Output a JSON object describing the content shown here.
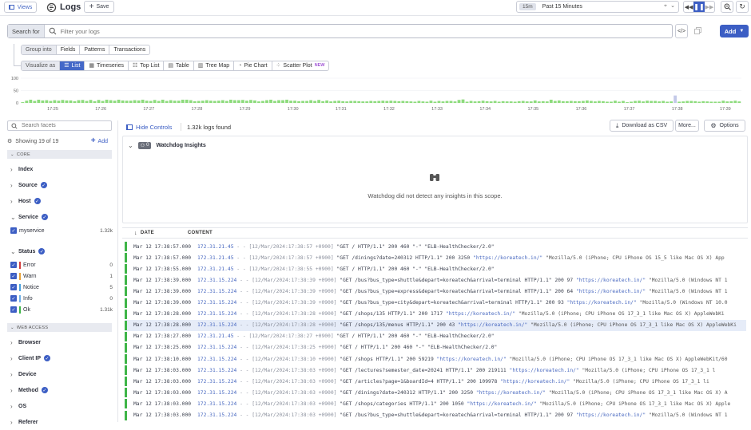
{
  "topbar": {
    "views_label": "Views",
    "title": "Logs",
    "save_label": "Save",
    "time_badge": "15m",
    "time_range": "Past 15 Minutes"
  },
  "search": {
    "label": "Search for",
    "placeholder": "Filter your logs",
    "add_label": "Add"
  },
  "group": {
    "label": "Group into",
    "options": [
      "Fields",
      "Patterns",
      "Transactions"
    ]
  },
  "visualize": {
    "label": "Visualize as",
    "options": [
      "List",
      "Timeseries",
      "Top List",
      "Table",
      "Tree Map",
      "Pie Chart",
      "Scatter Plot"
    ],
    "new_badge": "NEW"
  },
  "histogram": {
    "y_ticks": [
      "100",
      "50",
      "0"
    ],
    "x_ticks": [
      "17:25",
      "17:26",
      "17:27",
      "17:28",
      "17:29",
      "17:30",
      "17:31",
      "17:32",
      "17:33",
      "17:34",
      "17:35",
      "17:36",
      "17:37",
      "17:38",
      "17:39"
    ],
    "bars": [
      3,
      9,
      13,
      8,
      13,
      10,
      11,
      8,
      11,
      9,
      12,
      10,
      10,
      7,
      11,
      12,
      8,
      12,
      7,
      12,
      8,
      13,
      11,
      9,
      13,
      10,
      9,
      9,
      11,
      10,
      13,
      9,
      8,
      12,
      8,
      13,
      8,
      11,
      9,
      9,
      13,
      13,
      11,
      7,
      8,
      9,
      11,
      9,
      8,
      9,
      11,
      8,
      13,
      11,
      11,
      12,
      9,
      12,
      10,
      6,
      8,
      11,
      13,
      8,
      11,
      11,
      13,
      9,
      9,
      7,
      8,
      8,
      11,
      8,
      12,
      7,
      10,
      6,
      8,
      9,
      7,
      6,
      8,
      8,
      7,
      6,
      6,
      8,
      7,
      8,
      9,
      8,
      9,
      8,
      7,
      8,
      7,
      6,
      5,
      8,
      6,
      5,
      9,
      5,
      8,
      6,
      8,
      8,
      6,
      12,
      14,
      5,
      8,
      6,
      7,
      9,
      7,
      6,
      8,
      5,
      7,
      6,
      6,
      5,
      7,
      8,
      6,
      6,
      10,
      6,
      7,
      6,
      13,
      8,
      10,
      7,
      7,
      8,
      7,
      7,
      8,
      10,
      8,
      6,
      8,
      7,
      5,
      5,
      9,
      5,
      8,
      3,
      5,
      8,
      9,
      6,
      9,
      8,
      8,
      6,
      8,
      5,
      6,
      30,
      5,
      6,
      8,
      8,
      7,
      5,
      7,
      6,
      5,
      5,
      5,
      9,
      6,
      7,
      9,
      6
    ],
    "highlight_index": 163
  },
  "sidebar": {
    "search_placeholder": "Search facets",
    "showing": "Showing 19 of 19",
    "add_label": "Add",
    "core_label": "CORE",
    "core_facets": [
      "Index",
      "Source",
      "Host",
      "Service"
    ],
    "service_value": {
      "label": "myservice",
      "count": "1.32k"
    },
    "status_label": "Status",
    "statuses": [
      {
        "label": "Error",
        "count": "0",
        "color": "#d33d3d"
      },
      {
        "label": "Warn",
        "count": "1",
        "color": "#e8a33a"
      },
      {
        "label": "Notice",
        "count": "5",
        "color": "#4aa3df"
      },
      {
        "label": "Info",
        "count": "0",
        "color": "#6fb0e8"
      },
      {
        "label": "Ok",
        "count": "1.31k",
        "color": "#3fb548"
      }
    ],
    "web_label": "WEB ACCESS",
    "web_facets": [
      "Browser",
      "Client IP",
      "Device",
      "Method",
      "OS",
      "Referer"
    ]
  },
  "main": {
    "hide_controls": "Hide Controls",
    "logs_found": "1.32k logs found",
    "download": "Download as CSV",
    "more": "More...",
    "options": "Options",
    "watchdog_count": "0",
    "watchdog_title": "Watchdog Insights",
    "watchdog_empty": "Watchdog did not detect any insights in this scope.",
    "col_date": "DATE",
    "col_content": "CONTENT"
  },
  "logs": [
    {
      "date": "Mar 12 17:38:57.000",
      "ip": "172.31.21.45",
      "ts": "[12/Mar/2024:17:38:57 +0900]",
      "req": "\"GET / HTTP/1.1\" 200 460 \"-\" \"ELB-HealthChecker/2.0\"",
      "ref": "",
      "ua": ""
    },
    {
      "date": "Mar 12 17:38:57.000",
      "ip": "172.31.21.45",
      "ts": "[12/Mar/2024:17:38:57 +0900]",
      "req": "\"GET /dinings?date=240312 HTTP/1.1\" 200 3250",
      "ref": "\"https://koreatech.in/\"",
      "ua": "\"Mozilla/5.0 (iPhone; CPU iPhone OS 15_5 like Mac OS X) App"
    },
    {
      "date": "Mar 12 17:38:55.000",
      "ip": "172.31.21.45",
      "ts": "[12/Mar/2024:17:38:55 +0900]",
      "req": "\"GET / HTTP/1.1\" 200 460 \"-\" \"ELB-HealthChecker/2.0\"",
      "ref": "",
      "ua": ""
    },
    {
      "date": "Mar 12 17:38:39.000",
      "ip": "172.31.15.224",
      "ts": "[12/Mar/2024:17:38:39 +0900]",
      "req": "\"GET /bus?bus_type=shuttle&depart=koreatech&arrival=terminal HTTP/1.1\" 200 97",
      "ref": "\"https://koreatech.in/\"",
      "ua": "\"Mozilla/5.0 (Windows NT 1"
    },
    {
      "date": "Mar 12 17:38:39.000",
      "ip": "172.31.15.224",
      "ts": "[12/Mar/2024:17:38:39 +0900]",
      "req": "\"GET /bus?bus_type=express&depart=koreatech&arrival=terminal HTTP/1.1\" 200 64",
      "ref": "\"https://koreatech.in/\"",
      "ua": "\"Mozilla/5.0 (Windows NT 1"
    },
    {
      "date": "Mar 12 17:38:39.000",
      "ip": "172.31.15.224",
      "ts": "[12/Mar/2024:17:38:39 +0900]",
      "req": "\"GET /bus?bus_type=city&depart=koreatech&arrival=terminal HTTP/1.1\" 200 93",
      "ref": "\"https://koreatech.in/\"",
      "ua": "\"Mozilla/5.0 (Windows NT 10.0"
    },
    {
      "date": "Mar 12 17:38:28.000",
      "ip": "172.31.15.224",
      "ts": "[12/Mar/2024:17:38:28 +0900]",
      "req": "\"GET /shops/135 HTTP/1.1\" 200 1717",
      "ref": "\"https://koreatech.in/\"",
      "ua": "\"Mozilla/5.0 (iPhone; CPU iPhone OS 17_3_1 like Mac OS X) AppleWebKi"
    },
    {
      "date": "Mar 12 17:38:28.000",
      "ip": "172.31.15.224",
      "ts": "[12/Mar/2024:17:38:28 +0900]",
      "req": "\"GET /shops/135/menus HTTP/1.1\" 200 43",
      "ref": "\"https://koreatech.in/\"",
      "ua": "\"Mozilla/5.0 (iPhone; CPU iPhone OS 17_3_1 like Mac OS X) AppleWebKi"
    },
    {
      "date": "Mar 12 17:38:27.000",
      "ip": "172.31.21.45",
      "ts": "[12/Mar/2024:17:38:27 +0900]",
      "req": "\"GET / HTTP/1.1\" 200 460 \"-\" \"ELB-HealthChecker/2.0\"",
      "ref": "",
      "ua": ""
    },
    {
      "date": "Mar 12 17:38:25.000",
      "ip": "172.31.15.224",
      "ts": "[12/Mar/2024:17:38:25 +0900]",
      "req": "\"GET / HTTP/1.1\" 200 460 \"-\" \"ELB-HealthChecker/2.0\"",
      "ref": "",
      "ua": ""
    },
    {
      "date": "Mar 12 17:38:10.000",
      "ip": "172.31.15.224",
      "ts": "[12/Mar/2024:17:38:10 +0900]",
      "req": "\"GET /shops HTTP/1.1\" 200 59219",
      "ref": "\"https://koreatech.in/\"",
      "ua": "\"Mozilla/5.0 (iPhone; CPU iPhone OS 17_3_1 like Mac OS X) AppleWebKit/60"
    },
    {
      "date": "Mar 12 17:38:03.000",
      "ip": "172.31.15.224",
      "ts": "[12/Mar/2024:17:38:03 +0900]",
      "req": "\"GET /lectures?semester_date=20241 HTTP/1.1\" 200 219111",
      "ref": "\"https://koreatech.in/\"",
      "ua": "\"Mozilla/5.0 (iPhone; CPU iPhone OS 17_3_1 l"
    },
    {
      "date": "Mar 12 17:38:03.000",
      "ip": "172.31.15.224",
      "ts": "[12/Mar/2024:17:38:03 +0900]",
      "req": "\"GET /articles?page=1&boardId=4 HTTP/1.1\" 200 109978",
      "ref": "\"https://koreatech.in/\"",
      "ua": "\"Mozilla/5.0 (iPhone; CPU iPhone OS 17_3_1 li"
    },
    {
      "date": "Mar 12 17:38:03.000",
      "ip": "172.31.15.224",
      "ts": "[12/Mar/2024:17:38:03 +0900]",
      "req": "\"GET /dinings?date=240312 HTTP/1.1\" 200 3250",
      "ref": "\"https://koreatech.in/\"",
      "ua": "\"Mozilla/5.0 (iPhone; CPU iPhone OS 17_3_1 like Mac OS X) A"
    },
    {
      "date": "Mar 12 17:38:03.000",
      "ip": "172.31.15.224",
      "ts": "[12/Mar/2024:17:38:03 +0900]",
      "req": "\"GET /shops/categories HTTP/1.1\" 200 1050",
      "ref": "\"https://koreatech.in/\"",
      "ua": "\"Mozilla/5.0 (iPhone; CPU iPhone OS 17_3_1 like Mac OS X) Apple"
    },
    {
      "date": "Mar 12 17:38:03.000",
      "ip": "172.31.15.224",
      "ts": "[12/Mar/2024:17:38:03 +0900]",
      "req": "\"GET /bus?bus_type=shuttle&depart=koreatech&arrival=terminal HTTP/1.1\" 200 97",
      "ref": "\"https://koreatech.in/\"",
      "ua": "\"Mozilla/5.0 (Windows NT 1"
    }
  ],
  "selected_log_index": 7,
  "colors": {
    "accent": "#3c5ec4",
    "ok": "#3fb548",
    "bar": "#8ddb7c"
  }
}
